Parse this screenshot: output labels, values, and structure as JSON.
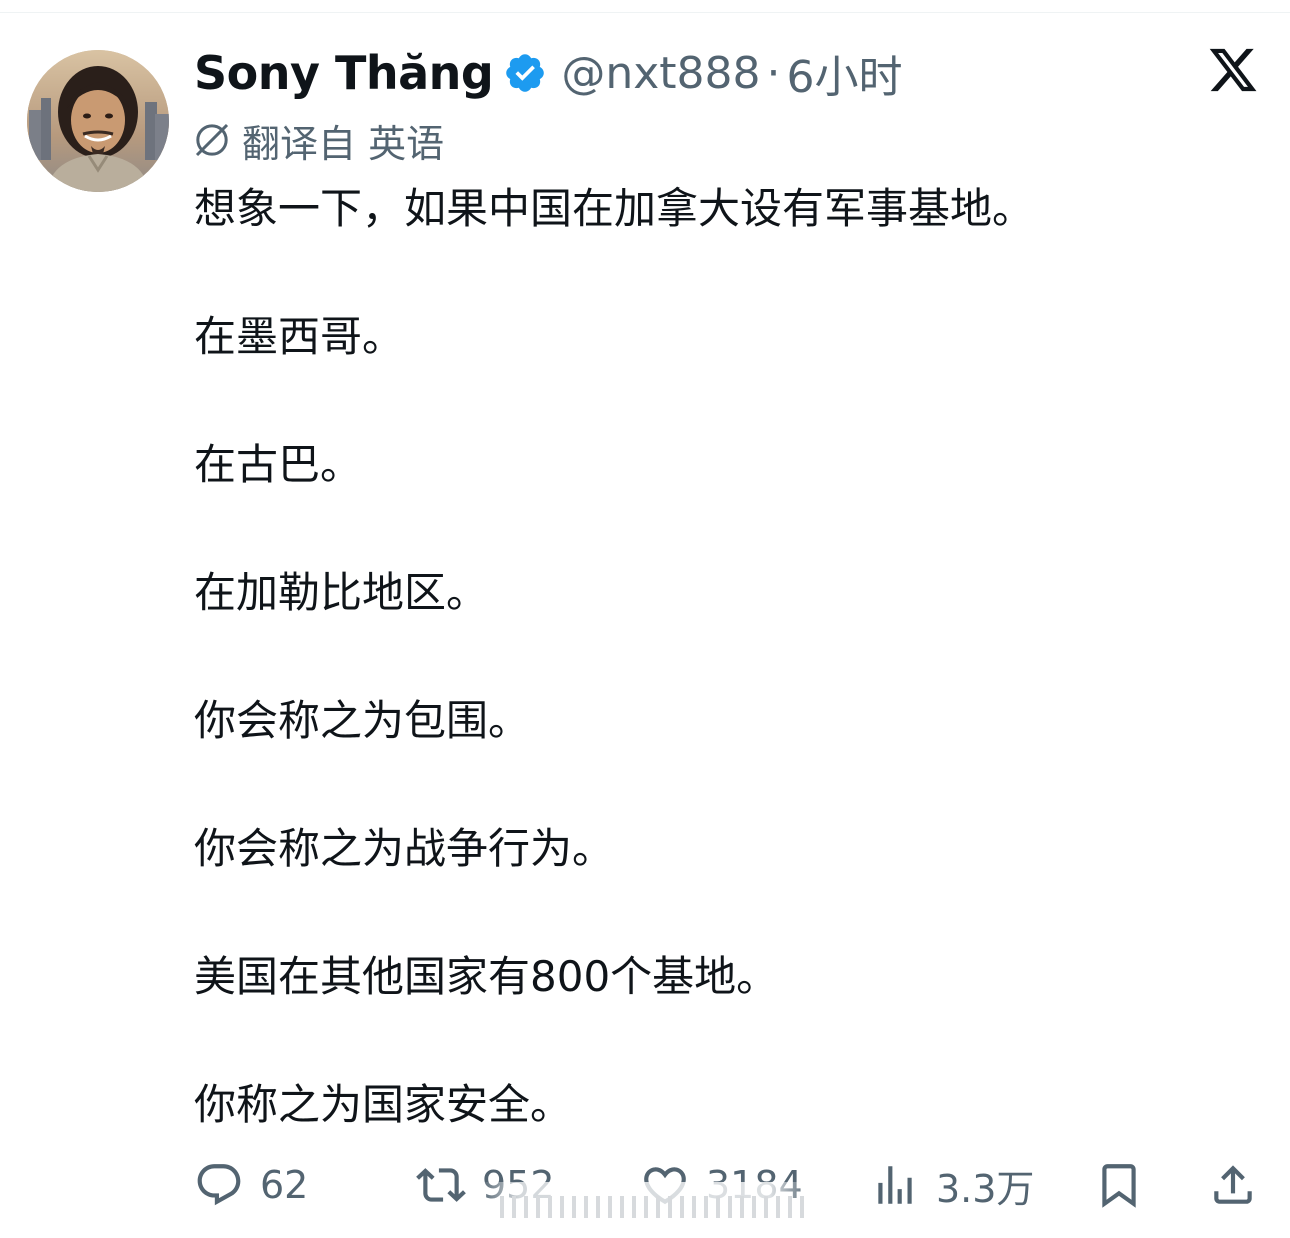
{
  "tweet": {
    "author": {
      "display_name": "Sony Thăng",
      "verified": true,
      "handle": "@nxt888",
      "separator": "·",
      "time": "6小时"
    },
    "translation": {
      "icon": "translate-globe-icon",
      "label": "翻译自 英语"
    },
    "lines": [
      "想象一下，如果中国在加拿大设有军事基地。",
      "在墨西哥。",
      "在古巴。",
      "在加勒比地区。",
      "你会称之为包围。",
      "你会称之为战争行为。",
      "美国在其他国家有800个基地。",
      "你称之为国家安全。"
    ],
    "actions": {
      "reply_count": "62",
      "retweet_count": "952",
      "like_count": "3184",
      "views_count": "3.3万"
    }
  },
  "colors": {
    "text_primary": "#0f1419",
    "text_secondary": "#536471",
    "verified_blue": "#1d9bf0"
  },
  "icons": [
    "x-logo-icon",
    "verified-badge-icon",
    "reply-icon",
    "retweet-icon",
    "like-icon",
    "views-icon",
    "bookmark-icon",
    "share-icon"
  ]
}
